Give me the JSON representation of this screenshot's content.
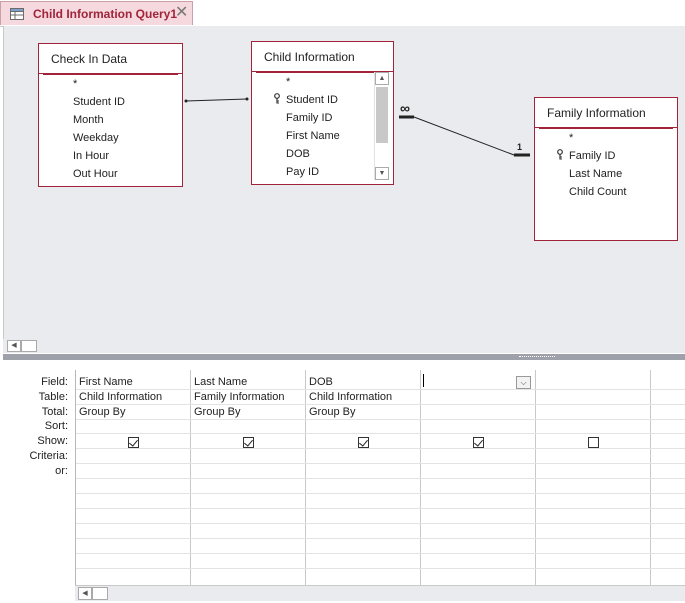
{
  "tab": {
    "title": "Child Information Query1",
    "close": "✕"
  },
  "tables": {
    "check_in": {
      "title": "Check In Data",
      "fields": [
        "*",
        "Student ID",
        "Month",
        "Weekday",
        "In Hour",
        "Out Hour"
      ]
    },
    "child_info": {
      "title": "Child Information",
      "fields": [
        "*",
        "Student ID",
        "Family ID",
        "First Name",
        "DOB",
        "Pay ID"
      ]
    },
    "family_info": {
      "title": "Family Information",
      "fields": [
        "*",
        "Family ID",
        "Last Name",
        "Child Count"
      ]
    }
  },
  "relationship": {
    "many_symbol": "∞",
    "one_symbol": "1"
  },
  "grid": {
    "row_labels": [
      "Field:",
      "Table:",
      "Total:",
      "Sort:",
      "Show:",
      "Criteria:",
      "or:"
    ],
    "columns": [
      {
        "field": "First Name",
        "table": "Child Information",
        "total": "Group By",
        "show": true
      },
      {
        "field": "Last Name",
        "table": "Family Information",
        "total": "Group By",
        "show": true
      },
      {
        "field": "DOB",
        "table": "Child Information",
        "total": "Group By",
        "show": true
      },
      {
        "field": "",
        "table": "",
        "total": "",
        "show": true
      },
      {
        "field": "",
        "table": "",
        "total": "",
        "show": false
      }
    ]
  },
  "scroll": {
    "left_arrow": "◀",
    "up_arrow": "▲",
    "down_arrow": "▼",
    "dropdown_arrow": "⌵"
  },
  "colors": {
    "accent": "#a1243a",
    "canvas": "#eaebef",
    "splitter": "#9ea0aa"
  },
  "icons": [
    "query-tab-icon",
    "primary-key-icon",
    "close-icon",
    "chevron-down-icon"
  ]
}
